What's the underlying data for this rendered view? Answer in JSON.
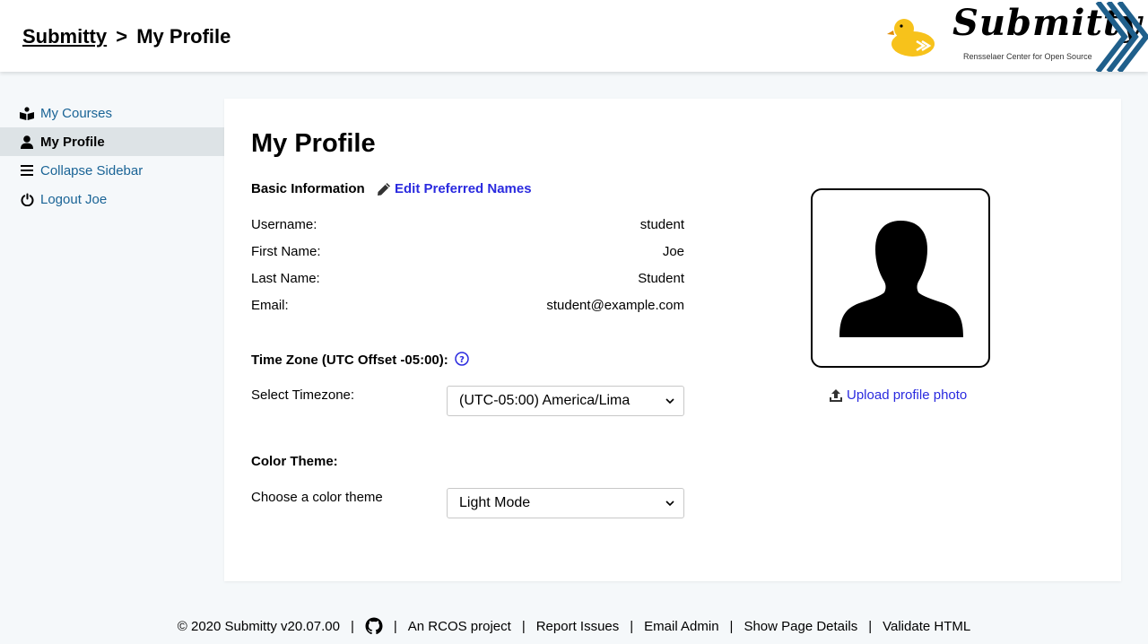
{
  "header": {
    "breadcrumb_root": "Submitty",
    "breadcrumb_separator": ">",
    "breadcrumb_current": "My Profile",
    "logo_word": "Submitty",
    "logo_subtitle": "Rensselaer Center for Open Source"
  },
  "sidebar": {
    "items": [
      {
        "label": "My Courses",
        "icon": "book-reader-icon"
      },
      {
        "label": "My Profile",
        "icon": "user-icon"
      },
      {
        "label": "Collapse Sidebar",
        "icon": "bars-icon"
      },
      {
        "label": "Logout Joe",
        "icon": "power-off-icon"
      }
    ]
  },
  "profile": {
    "title": "My Profile",
    "basic_info_label": "Basic Information",
    "edit_names_label": "Edit Preferred Names",
    "fields": [
      {
        "label": "Username:",
        "value": "student"
      },
      {
        "label": "First Name:",
        "value": "Joe"
      },
      {
        "label": "Last Name:",
        "value": "Student"
      },
      {
        "label": "Email:",
        "value": "student@example.com"
      }
    ],
    "timezone_label": "Time Zone (UTC Offset -05:00):",
    "select_timezone_label": "Select Timezone:",
    "timezone_value": "(UTC-05:00) America/Lima",
    "color_theme_label": "Color Theme:",
    "choose_theme_label": "Choose a color theme",
    "theme_value": "Light Mode",
    "upload_photo_label": "Upload profile photo"
  },
  "footer": {
    "copyright": "© 2020 Submitty v20.07.00",
    "rcos": "An RCOS project",
    "report": "Report Issues",
    "email": "Email Admin",
    "details": "Show Page Details",
    "validate": "Validate HTML"
  },
  "colors": {
    "link": "#1a6496",
    "accent_link": "#2a2adf",
    "logo_blue": "#1f5f8b",
    "duck_yellow": "#f7c21b"
  }
}
